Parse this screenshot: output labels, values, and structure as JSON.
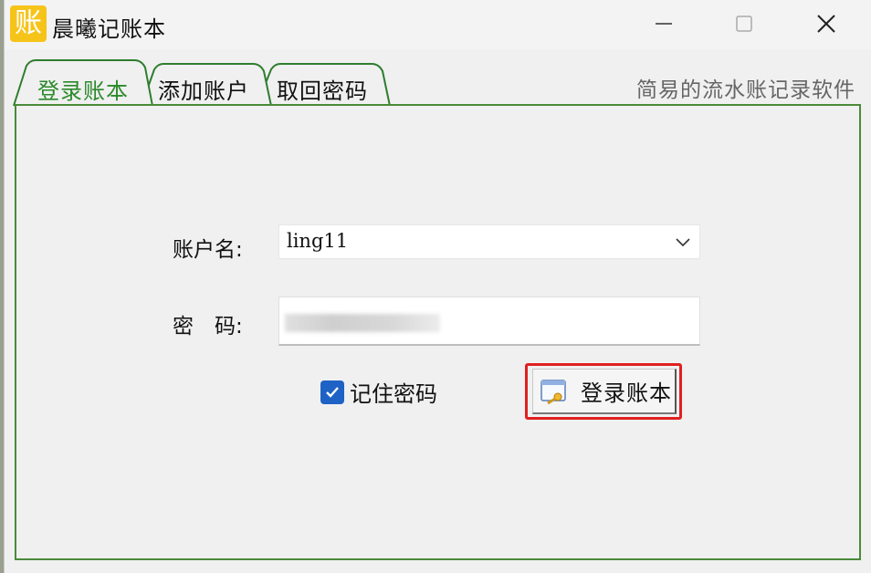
{
  "window": {
    "app_icon_glyph": "账",
    "title": "晨曦记账本"
  },
  "tabs": [
    {
      "label": "登录账本",
      "active": true
    },
    {
      "label": "添加账户",
      "active": false
    },
    {
      "label": "取回密码",
      "active": false
    }
  ],
  "tagline": "简易的流水账记录软件",
  "form": {
    "username_label": "账户名:",
    "username_value": "ling11",
    "password_label": "密　码:",
    "remember_label": "记住密码",
    "remember_checked": true,
    "login_button_label": "登录账本"
  },
  "colors": {
    "accent_green": "#2b8a2b",
    "checkbox_blue": "#1e62c6",
    "highlight_red": "#e02020",
    "app_icon_yellow": "#f6c419"
  }
}
